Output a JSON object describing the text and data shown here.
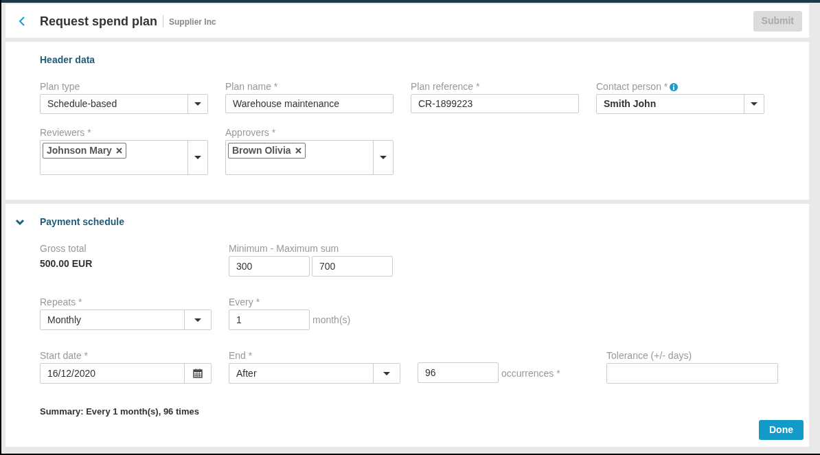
{
  "header": {
    "title": "Request spend plan",
    "subtitle": "Supplier Inc",
    "submit": {
      "label": "Submit",
      "disabled": true
    }
  },
  "header_data": {
    "title": "Header data",
    "rows": [
      [
        {
          "kind": "select",
          "label": "Plan type",
          "value": "Schedule-based"
        },
        {
          "kind": "input",
          "label": "Plan name  *",
          "value": "Warehouse maintenance"
        },
        {
          "kind": "input",
          "label": "Plan reference  *",
          "value": "CR-1899223"
        },
        {
          "kind": "person_select",
          "label": "Contact person  *",
          "value": "Smith John",
          "info": true
        }
      ],
      [
        {
          "kind": "multiselect",
          "label": "Reviewers  *",
          "tokens": [
            "Johnson Mary"
          ]
        },
        {
          "kind": "multiselect",
          "label": "Approvers  *",
          "tokens": [
            "Brown Olivia"
          ]
        }
      ]
    ]
  },
  "payment_schedule": {
    "title": "Payment schedule",
    "expanded": true,
    "gross_total": {
      "label": "Gross total",
      "value": "500.00 EUR"
    },
    "min_max": {
      "label": "Minimum - Maximum sum",
      "min": "300",
      "max": "700"
    },
    "repeats": {
      "label": "Repeats  *",
      "value": "Monthly"
    },
    "every": {
      "label": "Every  *",
      "value": "1",
      "unit": "month(s)"
    },
    "start_date": {
      "label": "Start date  *",
      "value": "16/12/2020"
    },
    "end": {
      "label": "End  *",
      "value": "After"
    },
    "occurrences": {
      "value": "96",
      "unit": "occurrences *"
    },
    "tolerance": {
      "label": "Tolerance (+/- days)"
    },
    "summary": "Summary: Every 1 month(s), 96 times",
    "done": "Done"
  }
}
